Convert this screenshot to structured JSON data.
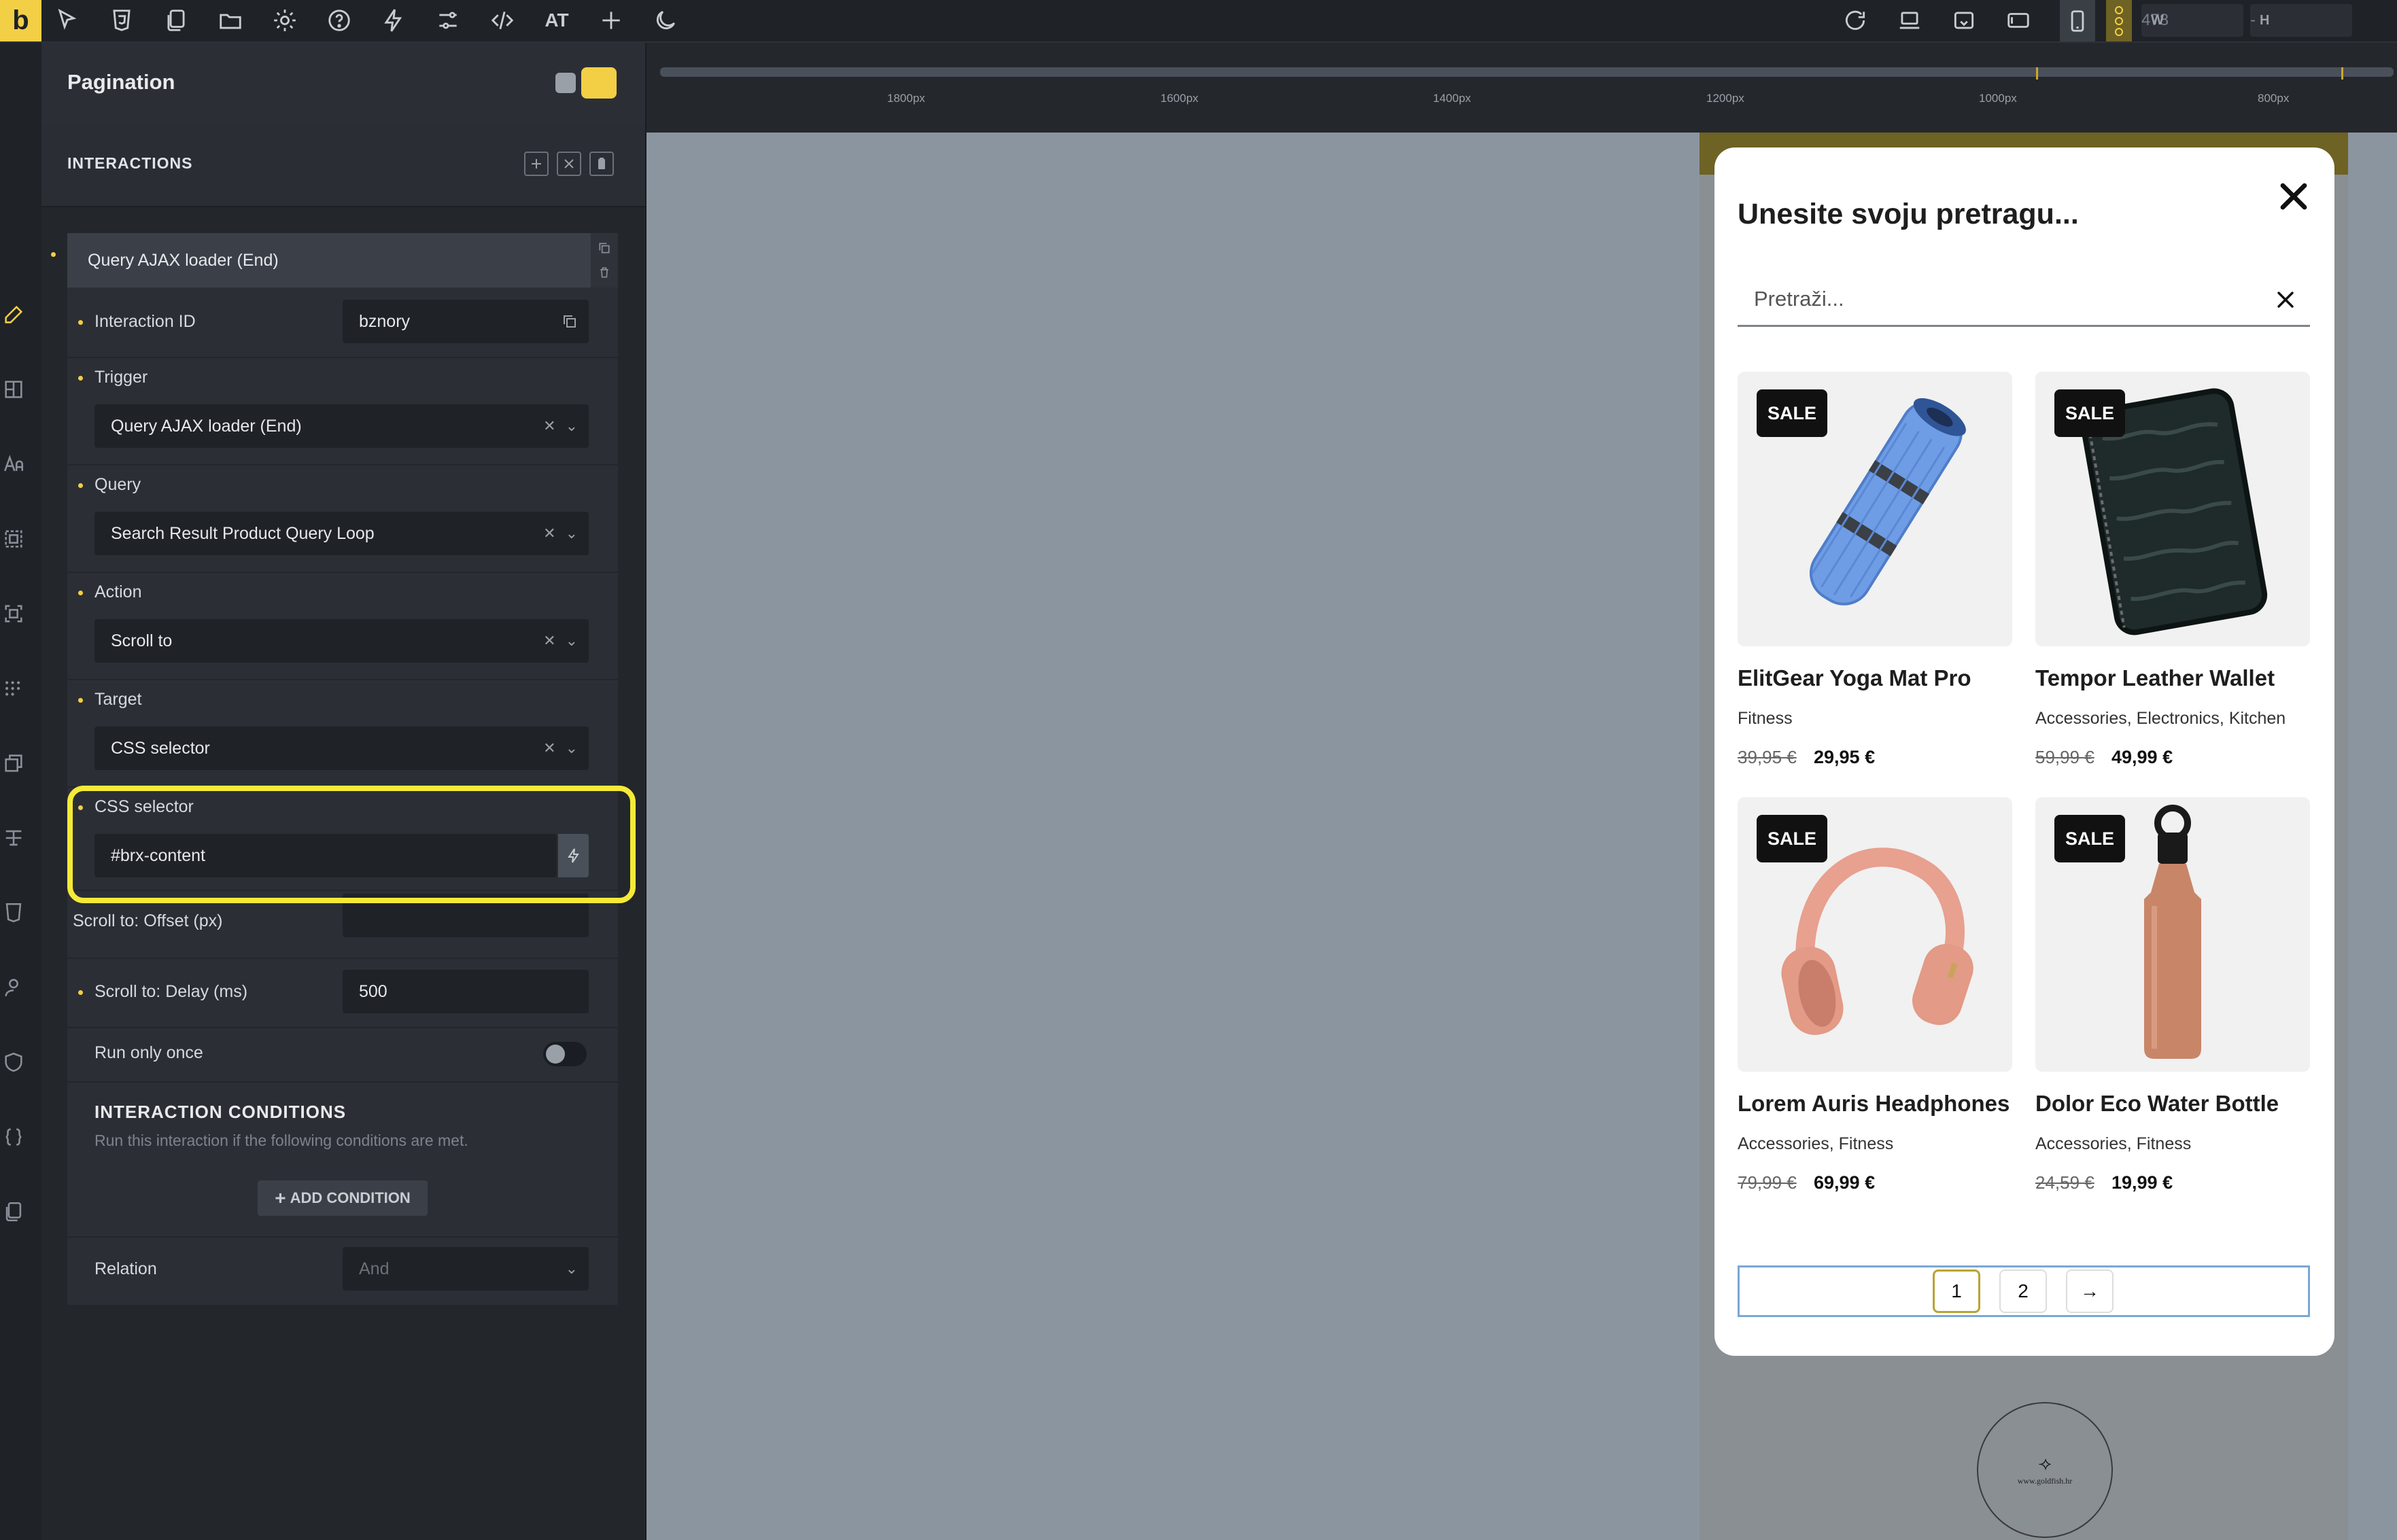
{
  "toolbar": {
    "logo": "b",
    "attributes_label": "AT",
    "width_label": "W",
    "width_value": "478",
    "height_label": "H",
    "height_value": "-"
  },
  "panel": {
    "title": "Pagination",
    "section_title": "INTERACTIONS",
    "interaction": {
      "header": "Query AJAX loader (End)",
      "id_label": "Interaction ID",
      "id_value": "bznory",
      "trigger_label": "Trigger",
      "trigger_value": "Query AJAX loader (End)",
      "query_label": "Query",
      "query_value": "Search Result Product Query Loop",
      "action_label": "Action",
      "action_value": "Scroll to",
      "target_label": "Target",
      "target_value": "CSS selector",
      "css_selector_label": "CSS selector",
      "css_selector_value": "#brx-content",
      "offset_label": "Scroll to: Offset (px)",
      "offset_value": "",
      "delay_label": "Scroll to: Delay (ms)",
      "delay_value": "500",
      "run_once_label": "Run only once",
      "run_once": false,
      "conditions_title": "INTERACTION CONDITIONS",
      "conditions_desc": "Run this interaction if the following conditions are met.",
      "add_condition": "ADD CONDITION",
      "relation_label": "Relation",
      "relation_value": "And"
    }
  },
  "ruler": {
    "labels": [
      "1800px",
      "1600px",
      "1400px",
      "1200px",
      "1000px",
      "800px"
    ]
  },
  "modal": {
    "title": "Unesite svoju pretragu...",
    "search_placeholder": "Pretraži...",
    "sale_badge": "SALE",
    "products": [
      {
        "name": "ElitGear Yoga Mat Pro",
        "categories": "Fitness",
        "old_price": "39,95 €",
        "price": "29,95 €",
        "icon": "yoga-mat"
      },
      {
        "name": "Tempor Leather Wallet",
        "categories": "Accessories, Electronics, Kitchen",
        "old_price": "59,99 €",
        "price": "49,99 €",
        "icon": "wallet"
      },
      {
        "name": "Lorem Auris Headphones",
        "categories": "Accessories, Fitness",
        "old_price": "79,99 €",
        "price": "69,99 €",
        "icon": "headphones"
      },
      {
        "name": "Dolor Eco Water Bottle",
        "categories": "Accessories, Fitness",
        "old_price": "24,59 €",
        "price": "19,99 €",
        "icon": "water-bottle"
      }
    ],
    "pagination": {
      "page1": "1",
      "page2": "2",
      "next": "→"
    }
  },
  "footer": {
    "logo_text": "www.goldfish.hr"
  },
  "colors": {
    "accent": "#f3cf45",
    "highlight": "#f5ea36",
    "pagination_border": "#7aa7d6"
  }
}
